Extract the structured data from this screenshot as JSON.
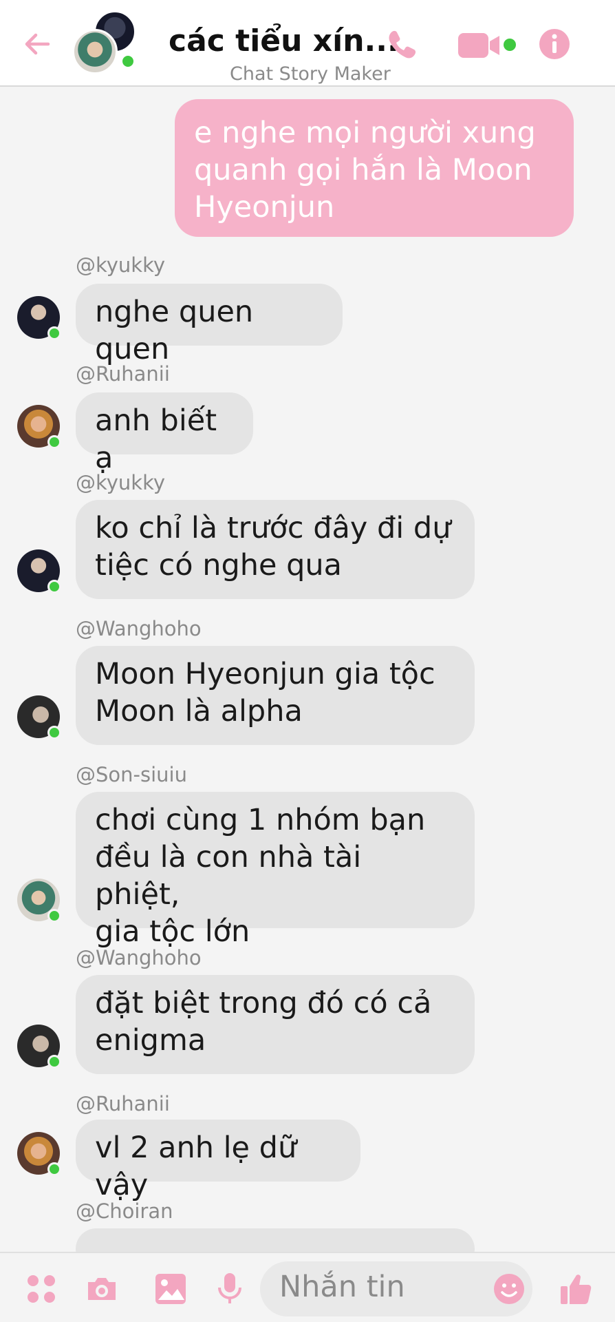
{
  "header": {
    "title": "các tiểu xín...",
    "subtitle": "Chat Story Maker",
    "back_icon": "back-arrow-icon",
    "call_icon": "phone-icon",
    "video_icon": "video-camera-icon",
    "info_icon": "info-icon",
    "accent_color": "#f6a9c4"
  },
  "messages": [
    {
      "from": "me",
      "text": [
        "e nghe mọi người xung",
        "quanh gọi hắn là Moon",
        "Hyeonjun"
      ]
    },
    {
      "sender": "@kyukky",
      "text": [
        "nghe quen quen"
      ]
    },
    {
      "sender": "@Ruhanii",
      "text": [
        "anh biết ạ"
      ]
    },
    {
      "sender": "@kyukky",
      "text": [
        "ko chỉ là trước đây đi dự",
        "tiệc có nghe qua"
      ]
    },
    {
      "sender": "@Wanghoho",
      "text": [
        "Moon Hyeonjun gia tộc",
        "Moon là alpha"
      ]
    },
    {
      "sender": "@Son-siuiu",
      "text": [
        "chơi cùng 1 nhóm bạn",
        "đều là con nhà tài phiệt,",
        "gia tộc lớn"
      ]
    },
    {
      "sender": "@Wanghoho",
      "text": [
        "đặt biệt trong đó có cả",
        "enigma"
      ]
    },
    {
      "sender": "@Ruhanii",
      "text": [
        "vl 2 anh lẹ dữ vậy"
      ]
    },
    {
      "sender": "@Choiran",
      "text": [
        ""
      ]
    }
  ],
  "composer": {
    "placeholder": "Nhắn tin",
    "icons": [
      "apps-icon",
      "camera-icon",
      "image-icon",
      "microphone-icon",
      "emoji-icon",
      "thumbs-up-icon"
    ]
  },
  "colors": {
    "my_bubble": "#f6b2c9",
    "other_bubble": "#e4e4e4",
    "online": "#3fc940"
  }
}
